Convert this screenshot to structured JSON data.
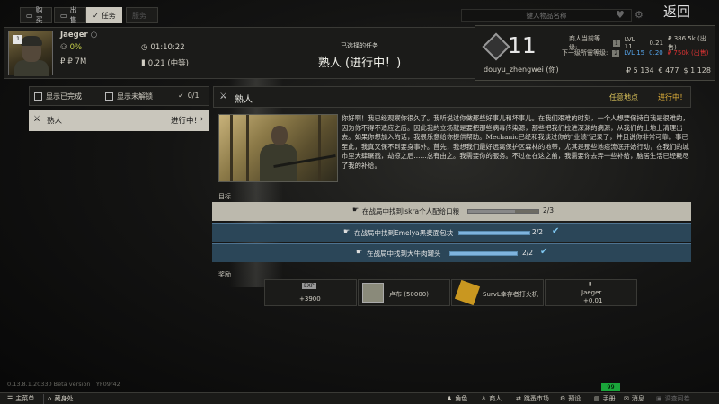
{
  "top": {
    "tabs": [
      "购买",
      "出售",
      "任务",
      "服务"
    ],
    "search_placeholder": "键入物品名称",
    "back": "返回"
  },
  "profile": {
    "name": "Jaeger",
    "level_badge": "1",
    "standing": "0%",
    "money": "₽ 7M",
    "timer": "01:10:22",
    "loyalty": "0.21 (中等)"
  },
  "quest_header": {
    "subtitle": "已选择的任务",
    "title": "熟人 (进行中！)"
  },
  "player": {
    "level": "11",
    "nickname": "douyu_zhengwei (你)",
    "cur_label": "商人当前等级:",
    "cur_chip": "1",
    "cur_lvl": "LVL 11",
    "cur_rep": "0.21",
    "cur_money": "₽ 386.5k (出售)",
    "next_label": "下一级所需等级:",
    "next_chip": "2",
    "next_lvl": "LVL 15",
    "next_rep": "0.20",
    "next_money": "₽ 750k (出售)",
    "rub": "₽ 5 134",
    "eur": "€ 477",
    "usd": "$ 1 128"
  },
  "filters": {
    "show_completed": "显示已完成",
    "show_locked": "显示未解锁",
    "count": "0/1"
  },
  "quest_list": [
    {
      "name": "熟人",
      "status": "进行中！"
    }
  ],
  "detail": {
    "name": "熟人",
    "location": "任意地点",
    "status": "进行中！",
    "description": "你好啊！我已经观察你很久了。我听说过你做那些好事儿和坏事儿。在我们艰难的时刻，一个人想要保持自我是很难的，因为你不得不适应之后。因此我的立场就是要把那些病毒传染源，那些把我们拉进深渊的病源，从我们的土地上清理出去。如果你想加入的话，我很乐意给你提供帮助。Mechanic已经和我谈过你的\"业绩\"记录了，并且说你非常可靠。事已至此，我真又保不到要身事外。首先，我想我们最好远离保护区森林的地带，尤其是那些地痞流氓开始行动，在我们的城市里大肆屠戮，劫掠之后……总有由之。我需要你的服务。不过在在这之前，我需要你去弄一些补给，脑居生活已经耗尽了我的补给。",
    "objectives_label": "目标",
    "objectives": [
      {
        "text": "在战局中找到Iskra个人配给口粮",
        "count": "2/3",
        "progress": 0.6667,
        "done": false
      },
      {
        "text": "在战局中找到Emelya黑麦面包块",
        "count": "2/2",
        "progress": 1,
        "done": true
      },
      {
        "text": "在战局中找到大牛肉罐头",
        "count": "2/2",
        "progress": 1,
        "done": true
      }
    ],
    "rewards_label": "奖励",
    "rewards": [
      {
        "icon_text": "EXP",
        "value": "+3900"
      },
      {
        "name": "卢布 (50000)"
      },
      {
        "name": "SurvL幸存者打火机"
      },
      {
        "name": "Jaeger",
        "value": "+0.01"
      }
    ]
  },
  "footer": {
    "version": "0.13.8.1.20330 Beta version | YF09r42",
    "fps": "99",
    "left": [
      "主菜单",
      "藏身处"
    ],
    "right": [
      "角色",
      "商人",
      "跳蚤市场",
      "预设",
      "手册",
      "消息",
      "调查问卷"
    ]
  }
}
